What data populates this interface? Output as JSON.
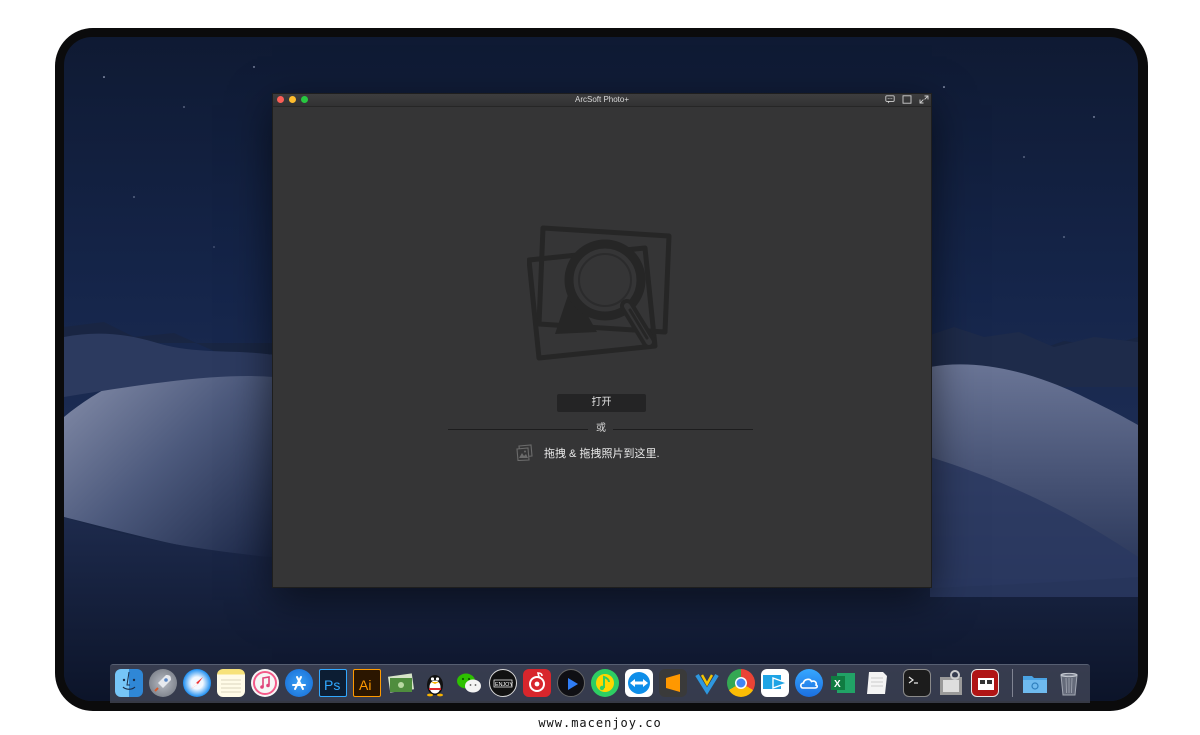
{
  "window": {
    "title": "ArcSoft Photo+"
  },
  "main": {
    "open_button_label": "打开",
    "or_label": "或",
    "drop_hint": "拖拽 & 拖拽照片到这里.",
    "hero_icon": "photo-search-icon",
    "drop_icon": "image-drop-icon"
  },
  "titlebar_icons": [
    "chat-icon",
    "window-toggle-icon",
    "fullscreen-icon"
  ],
  "dock": {
    "items": [
      {
        "name": "finder",
        "icon": "finder-icon",
        "color": "#3da9f5"
      },
      {
        "name": "launchpad",
        "icon": "launchpad-rocket-icon",
        "color": "#8a8f99"
      },
      {
        "name": "safari",
        "icon": "safari-compass-icon",
        "color": "#1e8ef0"
      },
      {
        "name": "notes",
        "icon": "notes-icon",
        "color": "#f7e37a"
      },
      {
        "name": "itunes",
        "icon": "music-note-icon",
        "color": "#f0f0f0"
      },
      {
        "name": "app-store",
        "icon": "app-store-icon",
        "color": "#1a86ec"
      },
      {
        "name": "photoshop",
        "icon": "photoshop-icon",
        "color": "#0c1d33",
        "text": "Ps"
      },
      {
        "name": "illustrator",
        "icon": "illustrator-icon",
        "color": "#2b1600",
        "text": "Ai"
      },
      {
        "name": "money-app",
        "icon": "money-icon",
        "color": "#3e7d3a"
      },
      {
        "name": "qq",
        "icon": "qq-penguin-icon",
        "color": "#101010"
      },
      {
        "name": "wechat",
        "icon": "wechat-icon",
        "color": "#2dc100"
      },
      {
        "name": "macenjoy",
        "icon": "enjoy-icon",
        "color": "#111111",
        "text": "ENJOY"
      },
      {
        "name": "netease-music",
        "icon": "netease-music-icon",
        "color": "#d8262c"
      },
      {
        "name": "player",
        "icon": "play-icon",
        "color": "#0f0f14"
      },
      {
        "name": "qq-music",
        "icon": "qq-music-icon",
        "color": "#2ece63"
      },
      {
        "name": "teamviewer",
        "icon": "teamviewer-icon",
        "color": "#0e8ee9"
      },
      {
        "name": "sublime-text",
        "icon": "sublime-icon",
        "color": "#2b2b2b"
      },
      {
        "name": "network-app",
        "icon": "network-icon",
        "color": "#2e97df"
      },
      {
        "name": "chrome",
        "icon": "chrome-icon",
        "color": "#f2f2f2"
      },
      {
        "name": "migration",
        "icon": "migration-arrow-icon",
        "color": "#1fa4e5"
      },
      {
        "name": "icloud",
        "icon": "cloud-icon",
        "color": "#1b8ef2"
      },
      {
        "name": "excel",
        "icon": "excel-icon",
        "color": "#1e7145"
      },
      {
        "name": "text-edit",
        "icon": "document-icon",
        "color": "#f4f4f4"
      },
      {
        "name": "terminal",
        "icon": "terminal-icon",
        "color": "#1c1c1c"
      },
      {
        "name": "preview",
        "icon": "preview-icon",
        "color": "#8d8d8d"
      },
      {
        "name": "photo-booth",
        "icon": "photo-booth-icon",
        "color": "#b01515"
      },
      {
        "name": "downloads-folder",
        "icon": "folder-icon",
        "color": "#4aa3e3"
      },
      {
        "name": "trash",
        "icon": "trash-icon",
        "color": "#6e7380"
      }
    ]
  },
  "footer": {
    "url": "www.macenjoy.co"
  }
}
